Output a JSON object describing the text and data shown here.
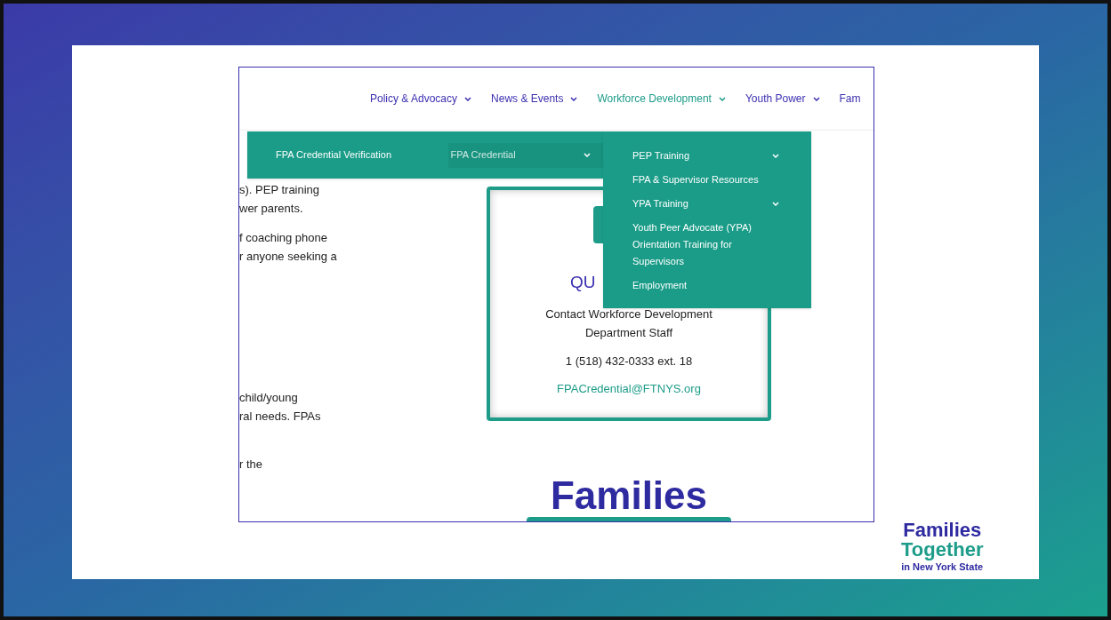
{
  "nav": [
    {
      "label": "Policy & Advocacy",
      "selected": false,
      "has_caret": true
    },
    {
      "label": "News & Events",
      "selected": false,
      "has_caret": true
    },
    {
      "label": "Workforce Development",
      "selected": true,
      "has_caret": true
    },
    {
      "label": "Youth Power",
      "selected": false,
      "has_caret": true
    },
    {
      "label": "Fam",
      "selected": false,
      "has_caret": false
    }
  ],
  "menu": {
    "items": [
      {
        "label": "FPA Credential Verification",
        "selected": false,
        "has_caret": false
      },
      {
        "label": "FPA Credential",
        "selected": true,
        "has_caret": true
      }
    ],
    "submenu": [
      {
        "label": "PEP Training",
        "has_caret": true
      },
      {
        "label": "FPA & Supervisor Resources",
        "has_caret": false
      },
      {
        "label": "YPA Training",
        "has_caret": true
      },
      {
        "label": "Youth Peer Advocate (YPA) Orientation Training for Supervisors",
        "has_caret": false
      },
      {
        "label": "Employment",
        "has_caret": false
      }
    ]
  },
  "body_paragraphs": [
    [
      "s). PEP training",
      "wer parents."
    ],
    [
      "f coaching phone",
      "r anyone seeking a"
    ],
    [
      "child/young",
      "ral needs. FPAs"
    ],
    [
      "r the"
    ]
  ],
  "contact_card": {
    "heading": "QU",
    "lines": [
      "Contact Workforce Development",
      "Department Staff"
    ],
    "phone": "1 (518) 432-0333 ext. 18",
    "email": "FPACredential@FTNYS.org"
  },
  "page_logo": {
    "text": "Families"
  },
  "slide_logo": {
    "line_1": "Families",
    "line_2": "Together",
    "line_3": "in New York State"
  }
}
